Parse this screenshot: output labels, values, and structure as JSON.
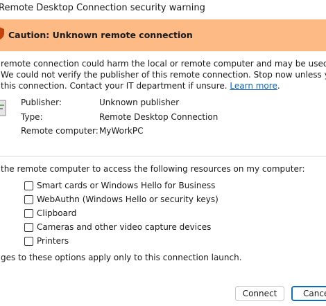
{
  "window": {
    "title": "Remote Desktop Connection security warning"
  },
  "banner": {
    "icon": "warning-shield-icon",
    "text": "Caution: Unknown remote connection",
    "color": "#fdba84"
  },
  "description": {
    "line1": "remote connection could harm the local or remote computer and may be used to steal passwords or",
    "line2": "We could not verify the publisher of this remote connection. Stop now unless you are certain you",
    "line3": "this connection. Contact your IT department if unsure.",
    "link": "Learn more",
    "link_suffix": "."
  },
  "details": {
    "icon": "document-icon",
    "publisher_label": "Publisher:",
    "publisher_value": "Unknown publisher",
    "type_label": "Type:",
    "type_value": "Remote Desktop Connection",
    "computer_label": "Remote computer:",
    "computer_value": "MyWorkPC"
  },
  "resources": {
    "heading": "the remote computer to access the following resources on my computer:",
    "items": [
      {
        "label": "Smart cards or Windows Hello for Business",
        "checked": false
      },
      {
        "label": "WebAuthn (Windows Hello or security keys)",
        "checked": false
      },
      {
        "label": "Clipboard",
        "checked": false
      },
      {
        "label": "Cameras and other video capture devices",
        "checked": false
      },
      {
        "label": "Printers",
        "checked": false
      }
    ],
    "note": "ges to these options apply only to this connection launch."
  },
  "buttons": {
    "connect": "Connect",
    "cancel": "Cance"
  },
  "colors": {
    "link": "#0b63c1",
    "default_button_border": "#0f6cbd"
  }
}
